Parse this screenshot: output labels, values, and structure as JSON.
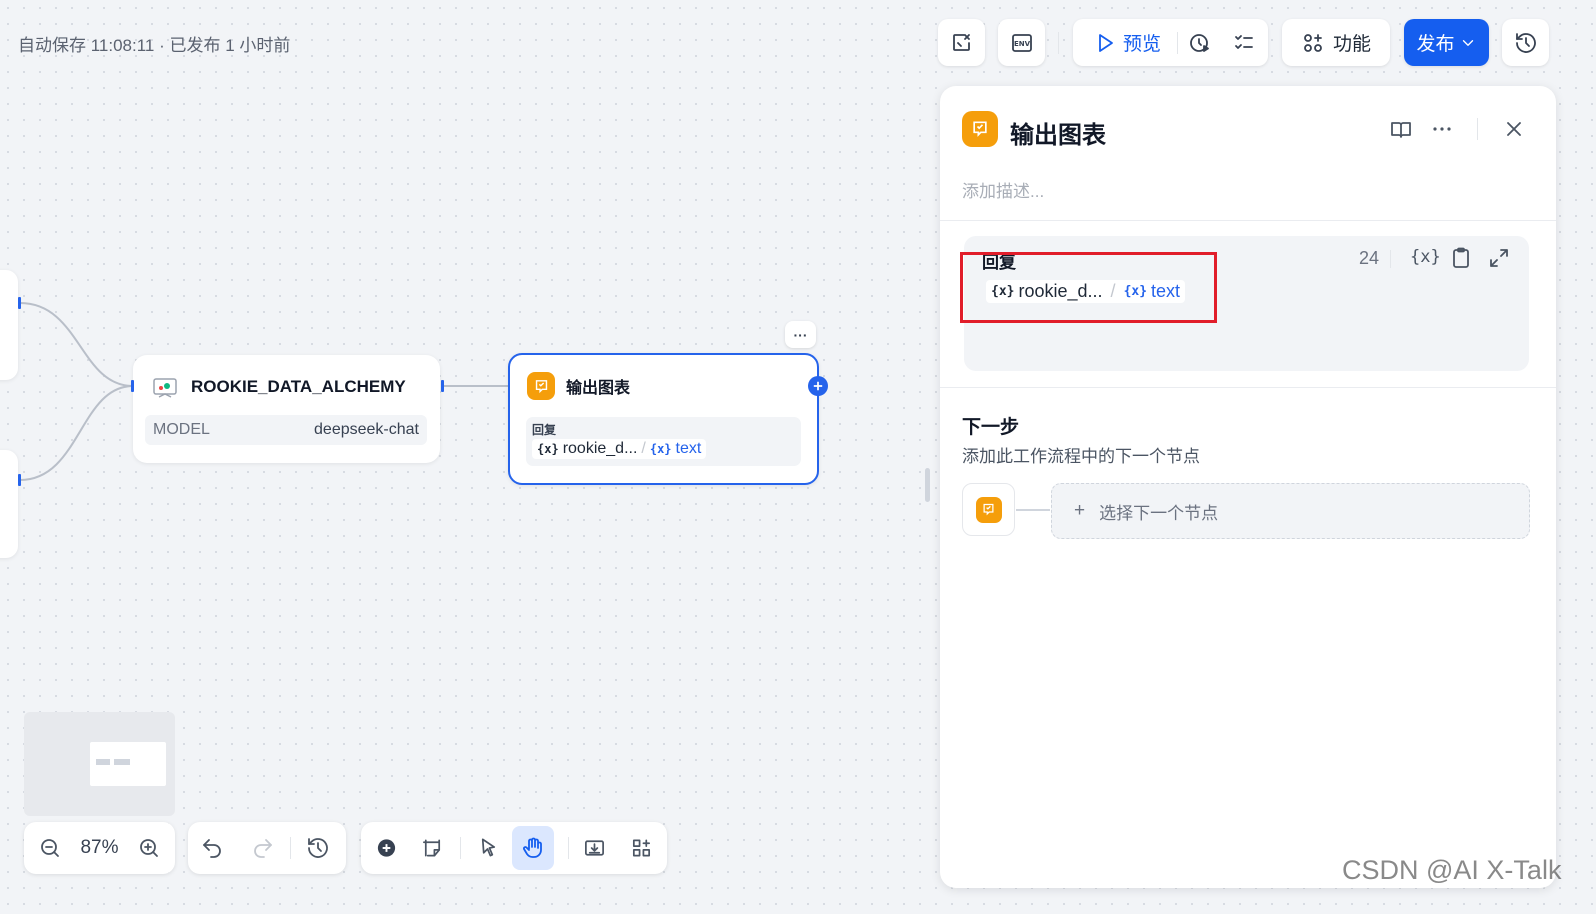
{
  "status_text": "自动保存 11:08:11 · 已发布 1 小时前",
  "toolbar": {
    "preview_label": "预览",
    "features_label": "功能",
    "publish_label": "发布"
  },
  "canvas": {
    "llm_node": {
      "title": "ROOKIE_DATA_ALCHEMY",
      "model_label": "MODEL",
      "model_value": "deepseek-chat"
    },
    "answer_node": {
      "title": "输出图表",
      "field_label": "回复",
      "var_node": "rookie_d...",
      "var_sep": "/",
      "var_name": "text",
      "more": "···"
    },
    "zoom": "87%"
  },
  "panel": {
    "title": "输出图表",
    "desc_placeholder": "添加描述...",
    "reply_label": "回复",
    "reply_count": "24",
    "var_insert": "{x}",
    "var_node": "rookie_d...",
    "var_sep": "/",
    "var_name": "text",
    "next_title": "下一步",
    "next_desc": "添加此工作流程中的下一个节点",
    "next_select": "选择下一个节点",
    "next_plus": "+"
  },
  "watermark": "CSDN @AI X-Talk",
  "colors": {
    "accent": "#155eef",
    "node_orange": "#f59e0b",
    "highlight_red": "#e11d2a",
    "variable_blue": "#2563eb"
  }
}
